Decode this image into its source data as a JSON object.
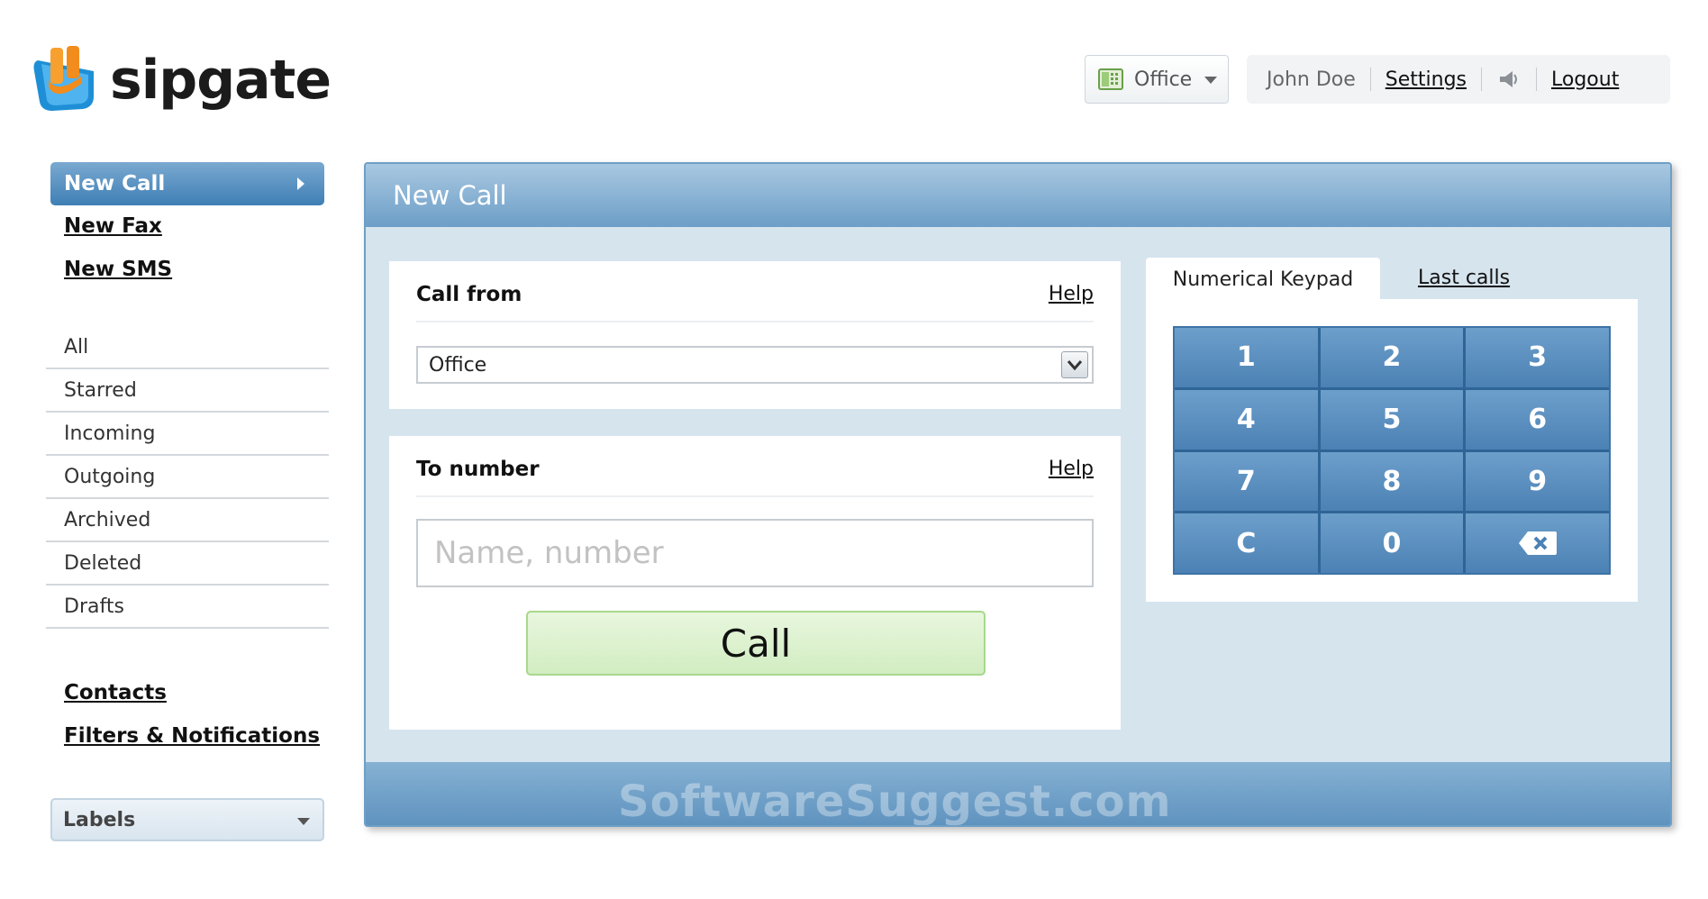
{
  "brand": {
    "name": "sipgate",
    "colors": {
      "logo_blue": "#1e8fd6",
      "logo_orange": "#f28c1c"
    }
  },
  "header": {
    "device": {
      "icon": "phone-icon",
      "label": "Office"
    },
    "user": "John Doe",
    "settings_label": "Settings",
    "speaker_icon": "speaker-icon",
    "logout_label": "Logout"
  },
  "sidebar": {
    "compose": [
      {
        "label": "New Call",
        "active": true
      },
      {
        "label": "New Fax"
      },
      {
        "label": "New SMS"
      }
    ],
    "folders": [
      "All",
      "Starred",
      "Incoming",
      "Outgoing",
      "Archived",
      "Deleted",
      "Drafts"
    ],
    "links": [
      "Contacts",
      "Filters & Notifications"
    ],
    "labels_label": "Labels"
  },
  "main": {
    "title": "New Call",
    "call_from": {
      "title": "Call from",
      "help": "Help",
      "selected": "Office"
    },
    "to_number": {
      "title": "To number",
      "help": "Help",
      "placeholder": "Name, number",
      "value": ""
    },
    "call_button": "Call",
    "tabs": [
      {
        "label": "Numerical Keypad",
        "active": true
      },
      {
        "label": "Last calls"
      }
    ],
    "keypad": [
      "1",
      "2",
      "3",
      "4",
      "5",
      "6",
      "7",
      "8",
      "9",
      "C",
      "0"
    ],
    "keypad_backspace_icon": "backspace-icon"
  },
  "watermark": "SoftwareSuggest.com",
  "colors": {
    "accent": "#4a85b8",
    "panel_bg": "#d6e4ee",
    "call_green": "#d2edc1"
  }
}
